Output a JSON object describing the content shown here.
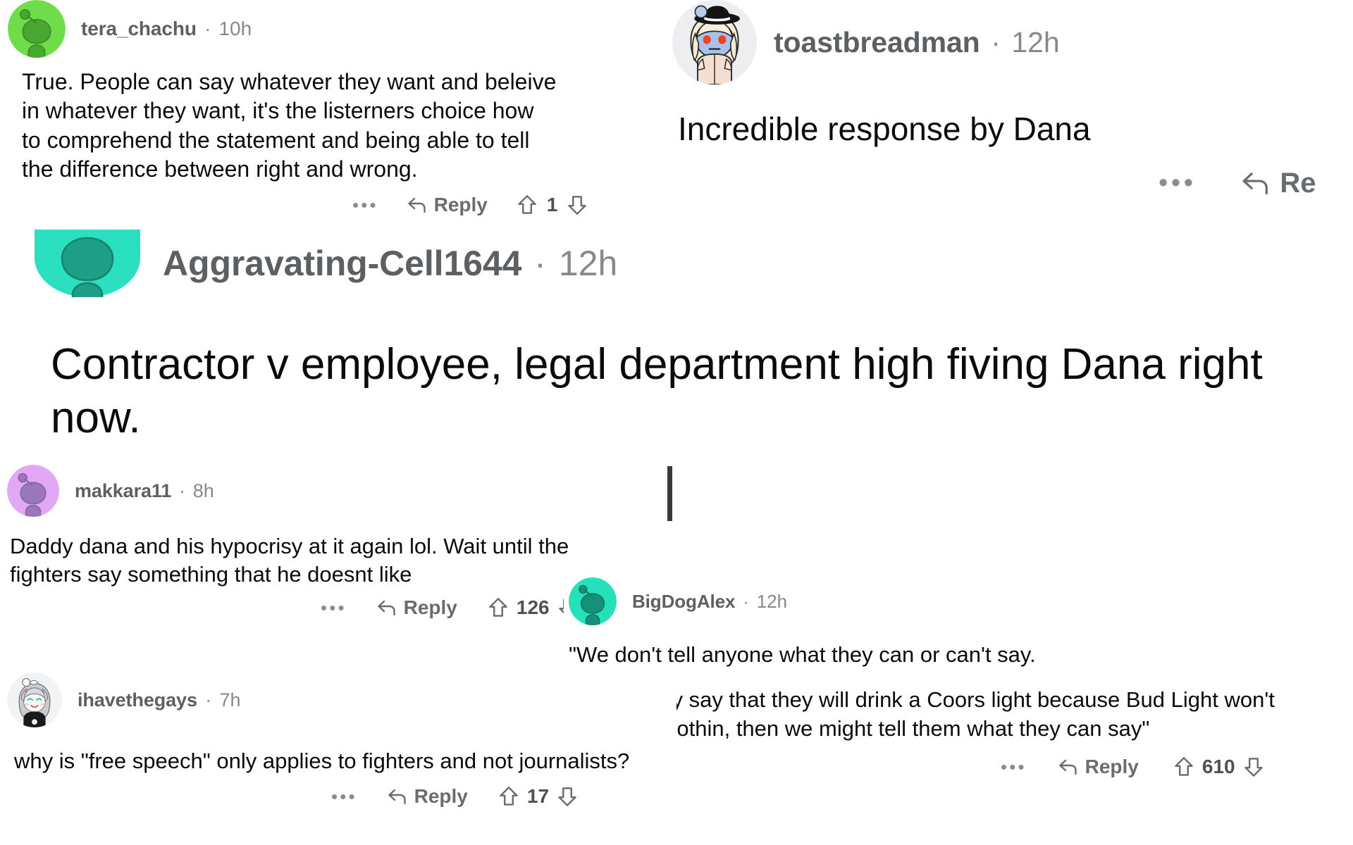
{
  "app": {
    "kind": "reddit-comment-collage",
    "background_color": "#ffffff",
    "username_color": "#5c6063",
    "meta_color": "#87898c",
    "action_color": "#6a6d70"
  },
  "comments": [
    {
      "id": "tera_chachu",
      "username": "tera_chachu",
      "separator": "·",
      "age": "10h",
      "avatar": {
        "name": "snoo-avatar-green",
        "bg": "#6fdc4a",
        "fg": "#4aa832"
      },
      "paragraphs": [
        "True. People can say whatever they want and beleive in whatever they want, it's the listerners choice how to comprehend the statement and being able to tell the difference between right and wrong."
      ],
      "actions": {
        "more_label": "•••",
        "reply_label": "Reply",
        "upvote_label": "upvote",
        "downvote_label": "downvote",
        "score": "1"
      }
    },
    {
      "id": "toastbreadman",
      "username": "toastbreadman",
      "separator": "·",
      "age": "12h",
      "avatar": {
        "name": "snoo-avatar-blue-fedora",
        "bg": "#eceef0",
        "fg": "#a9c2ec"
      },
      "paragraphs": [
        "Incredible response by Dana"
      ],
      "actions": {
        "more_label": "•••",
        "reply_label": "Re",
        "upvote_label": "upvote",
        "downvote_label": "downvote",
        "score": ""
      }
    },
    {
      "id": "aggravating_cell1644",
      "username": "Aggravating-Cell1644",
      "separator": "·",
      "age": "12h",
      "avatar": {
        "name": "snoo-avatar-teal",
        "bg": "#2ae0c0",
        "fg": "#1f9e86"
      },
      "paragraphs": [
        "Contractor v employee, legal department high fiving Dana right now."
      ],
      "actions": null
    },
    {
      "id": "makkara11",
      "username": "makkara11",
      "separator": "·",
      "age": "8h",
      "avatar": {
        "name": "snoo-avatar-purple",
        "bg": "#e2a7f5",
        "fg": "#9a78b8"
      },
      "paragraphs": [
        "Daddy dana and his hypocrisy at it again lol. Wait until the fighters say something that he doesnt like"
      ],
      "actions": {
        "more_label": "•••",
        "reply_label": "Reply",
        "upvote_label": "upvote",
        "downvote_label": "downvote",
        "score": "126"
      }
    },
    {
      "id": "bigdogalex",
      "username": "BigDogAlex",
      "separator": "·",
      "age": "12h",
      "avatar": {
        "name": "snoo-avatar-mint",
        "bg": "#25e0b8",
        "fg": "#17907a"
      },
      "paragraphs": [
        "\"We don't tell anyone what they can or can't say.",
        "Unless they say that they will drink a Coors light because Bud Light won't pay them nothin, then we might tell them what they can say\""
      ],
      "actions": {
        "more_label": "•••",
        "reply_label": "Reply",
        "upvote_label": "upvote",
        "downvote_label": "downvote",
        "score": "610"
      }
    },
    {
      "id": "ihavethegays",
      "username": "ihavethegays",
      "separator": "·",
      "age": "7h",
      "avatar": {
        "name": "anime-avatar-silver-hair",
        "bg": "#f2f3f4",
        "fg": "#c9ccd0"
      },
      "paragraphs": [
        "why is \"free speech\" only applies to fighters and not journalists?"
      ],
      "actions": {
        "more_label": "•••",
        "reply_label": "Reply",
        "upvote_label": "upvote",
        "downvote_label": "downvote",
        "score": "17"
      }
    }
  ]
}
